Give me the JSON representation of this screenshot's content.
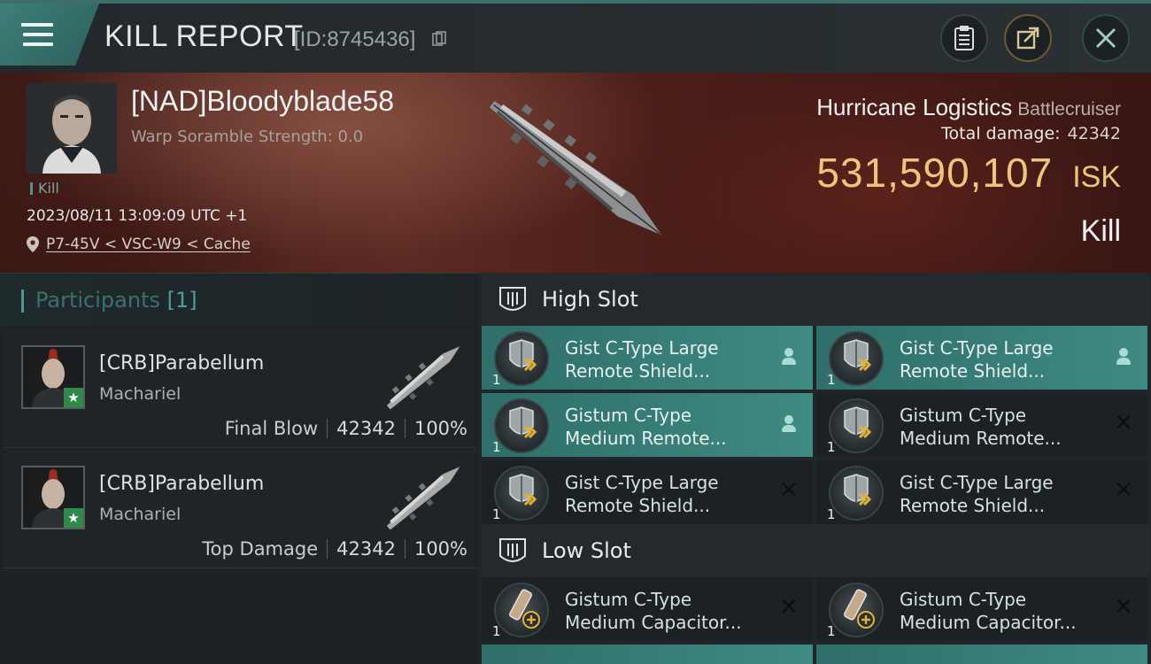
{
  "header": {
    "title": "KILL REPORT",
    "report_id": "[ID:8745436]",
    "icons": [
      "menu-icon",
      "copy-icon",
      "clipboard-icon",
      "share-icon",
      "close-icon"
    ]
  },
  "victim": {
    "name": "[NAD]Bloodyblade58",
    "scramble": "Warp Soramble Strength: 0.0",
    "kill_tag": "Kill",
    "datetime": "2023/08/11 13:09:09 UTC +1",
    "location": "P7-45V < VSC-W9 < Cache",
    "ship_name": "Hurricane Logistics",
    "ship_class": "Battlecruiser",
    "total_damage_label": "Total damage:",
    "total_damage": "42342",
    "isk_value": "531,590,107",
    "isk_unit": "ISK",
    "result": "Kill"
  },
  "participants": {
    "label": "Participants",
    "count": "[1]",
    "rows": [
      {
        "name": "[CRB]Parabellum",
        "ship": "Machariel",
        "tag": "Final Blow",
        "damage": "42342",
        "percent": "100%"
      },
      {
        "name": "[CRB]Parabellum",
        "ship": "Machariel",
        "tag": "Top Damage",
        "damage": "42342",
        "percent": "100%"
      }
    ]
  },
  "high_slot": {
    "label": "High Slot",
    "modules": [
      {
        "qty": "1",
        "line1": "Gist C-Type Large",
        "line2": "Remote Shield...",
        "status": "person",
        "active": true
      },
      {
        "qty": "1",
        "line1": "Gist C-Type Large",
        "line2": "Remote Shield...",
        "status": "person",
        "active": true
      },
      {
        "qty": "1",
        "line1": "Gistum C-Type",
        "line2": "Medium Remote...",
        "status": "person",
        "active": true
      },
      {
        "qty": "1",
        "line1": "Gistum C-Type",
        "line2": "Medium Remote...",
        "status": "cross",
        "active": false
      },
      {
        "qty": "1",
        "line1": "Gist C-Type Large",
        "line2": "Remote Shield...",
        "status": "cross",
        "active": false
      },
      {
        "qty": "1",
        "line1": "Gist C-Type Large",
        "line2": "Remote Shield...",
        "status": "cross",
        "active": false
      }
    ]
  },
  "low_slot": {
    "label": "Low Slot",
    "modules": [
      {
        "qty": "1",
        "line1": "Gistum C-Type",
        "line2": "Medium Capacitor...",
        "status": "cross",
        "active": false
      },
      {
        "qty": "1",
        "line1": "Gistum C-Type",
        "line2": "Medium Capacitor...",
        "status": "cross",
        "active": false
      }
    ]
  },
  "colors": {
    "accent_teal": "#3f8a83",
    "isk_gold": "#ecc57e",
    "hero_red": "#5b2a22",
    "panel_bg": "#1d2225"
  }
}
